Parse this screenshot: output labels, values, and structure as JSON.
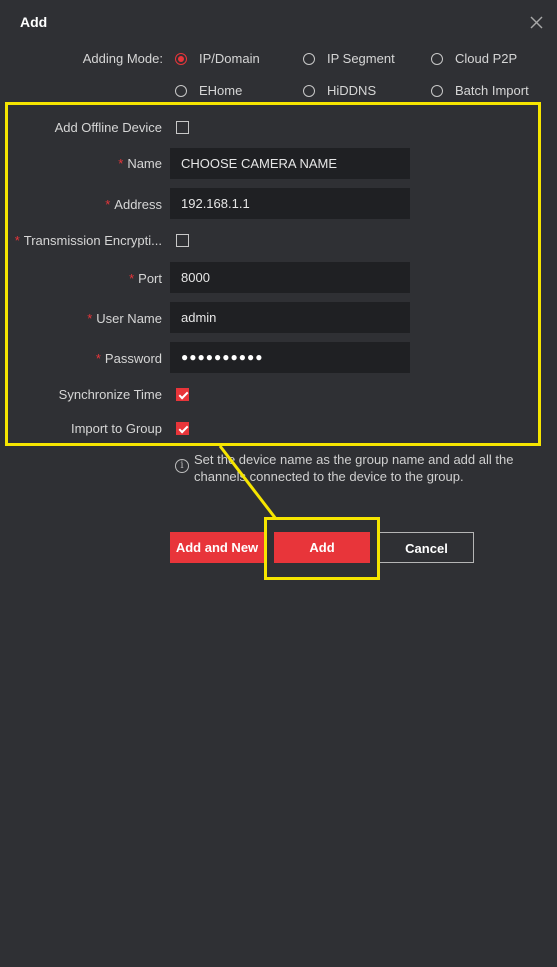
{
  "dialog": {
    "title": "Add"
  },
  "adding_mode": {
    "label": "Adding Mode:",
    "options": [
      {
        "label": "IP/Domain",
        "selected": true
      },
      {
        "label": "IP Segment",
        "selected": false
      },
      {
        "label": "Cloud P2P",
        "selected": false
      },
      {
        "label": "EHome",
        "selected": false
      },
      {
        "label": "HiDDNS",
        "selected": false
      },
      {
        "label": "Batch Import",
        "selected": false
      }
    ]
  },
  "form": {
    "offline_label": "Add Offline Device",
    "offline_checked": false,
    "name_label": "Name",
    "name_value": "CHOOSE CAMERA NAME",
    "address_label": "Address",
    "address_value": "192.168.1.1",
    "encryption_label": "Transmission Encrypti...",
    "encryption_checked": false,
    "port_label": "Port",
    "port_value": "8000",
    "user_label": "User Name",
    "user_value": "admin",
    "password_label": "Password",
    "password_value": "●●●●●●●●●●",
    "sync_label": "Synchronize Time",
    "sync_checked": true,
    "group_label": "Import to Group",
    "group_checked": true,
    "required_mark": "*"
  },
  "info": {
    "icon": "info-icon",
    "glyph": "i",
    "text": "Set the device name as the group name and add all the channels connected to the device to the group."
  },
  "buttons": {
    "add_new": "Add and New",
    "add": "Add",
    "cancel": "Cancel"
  },
  "colors": {
    "background": "#2f3034",
    "accent": "#e8353a",
    "highlight": "#f6e500",
    "field": "#1f2023"
  }
}
